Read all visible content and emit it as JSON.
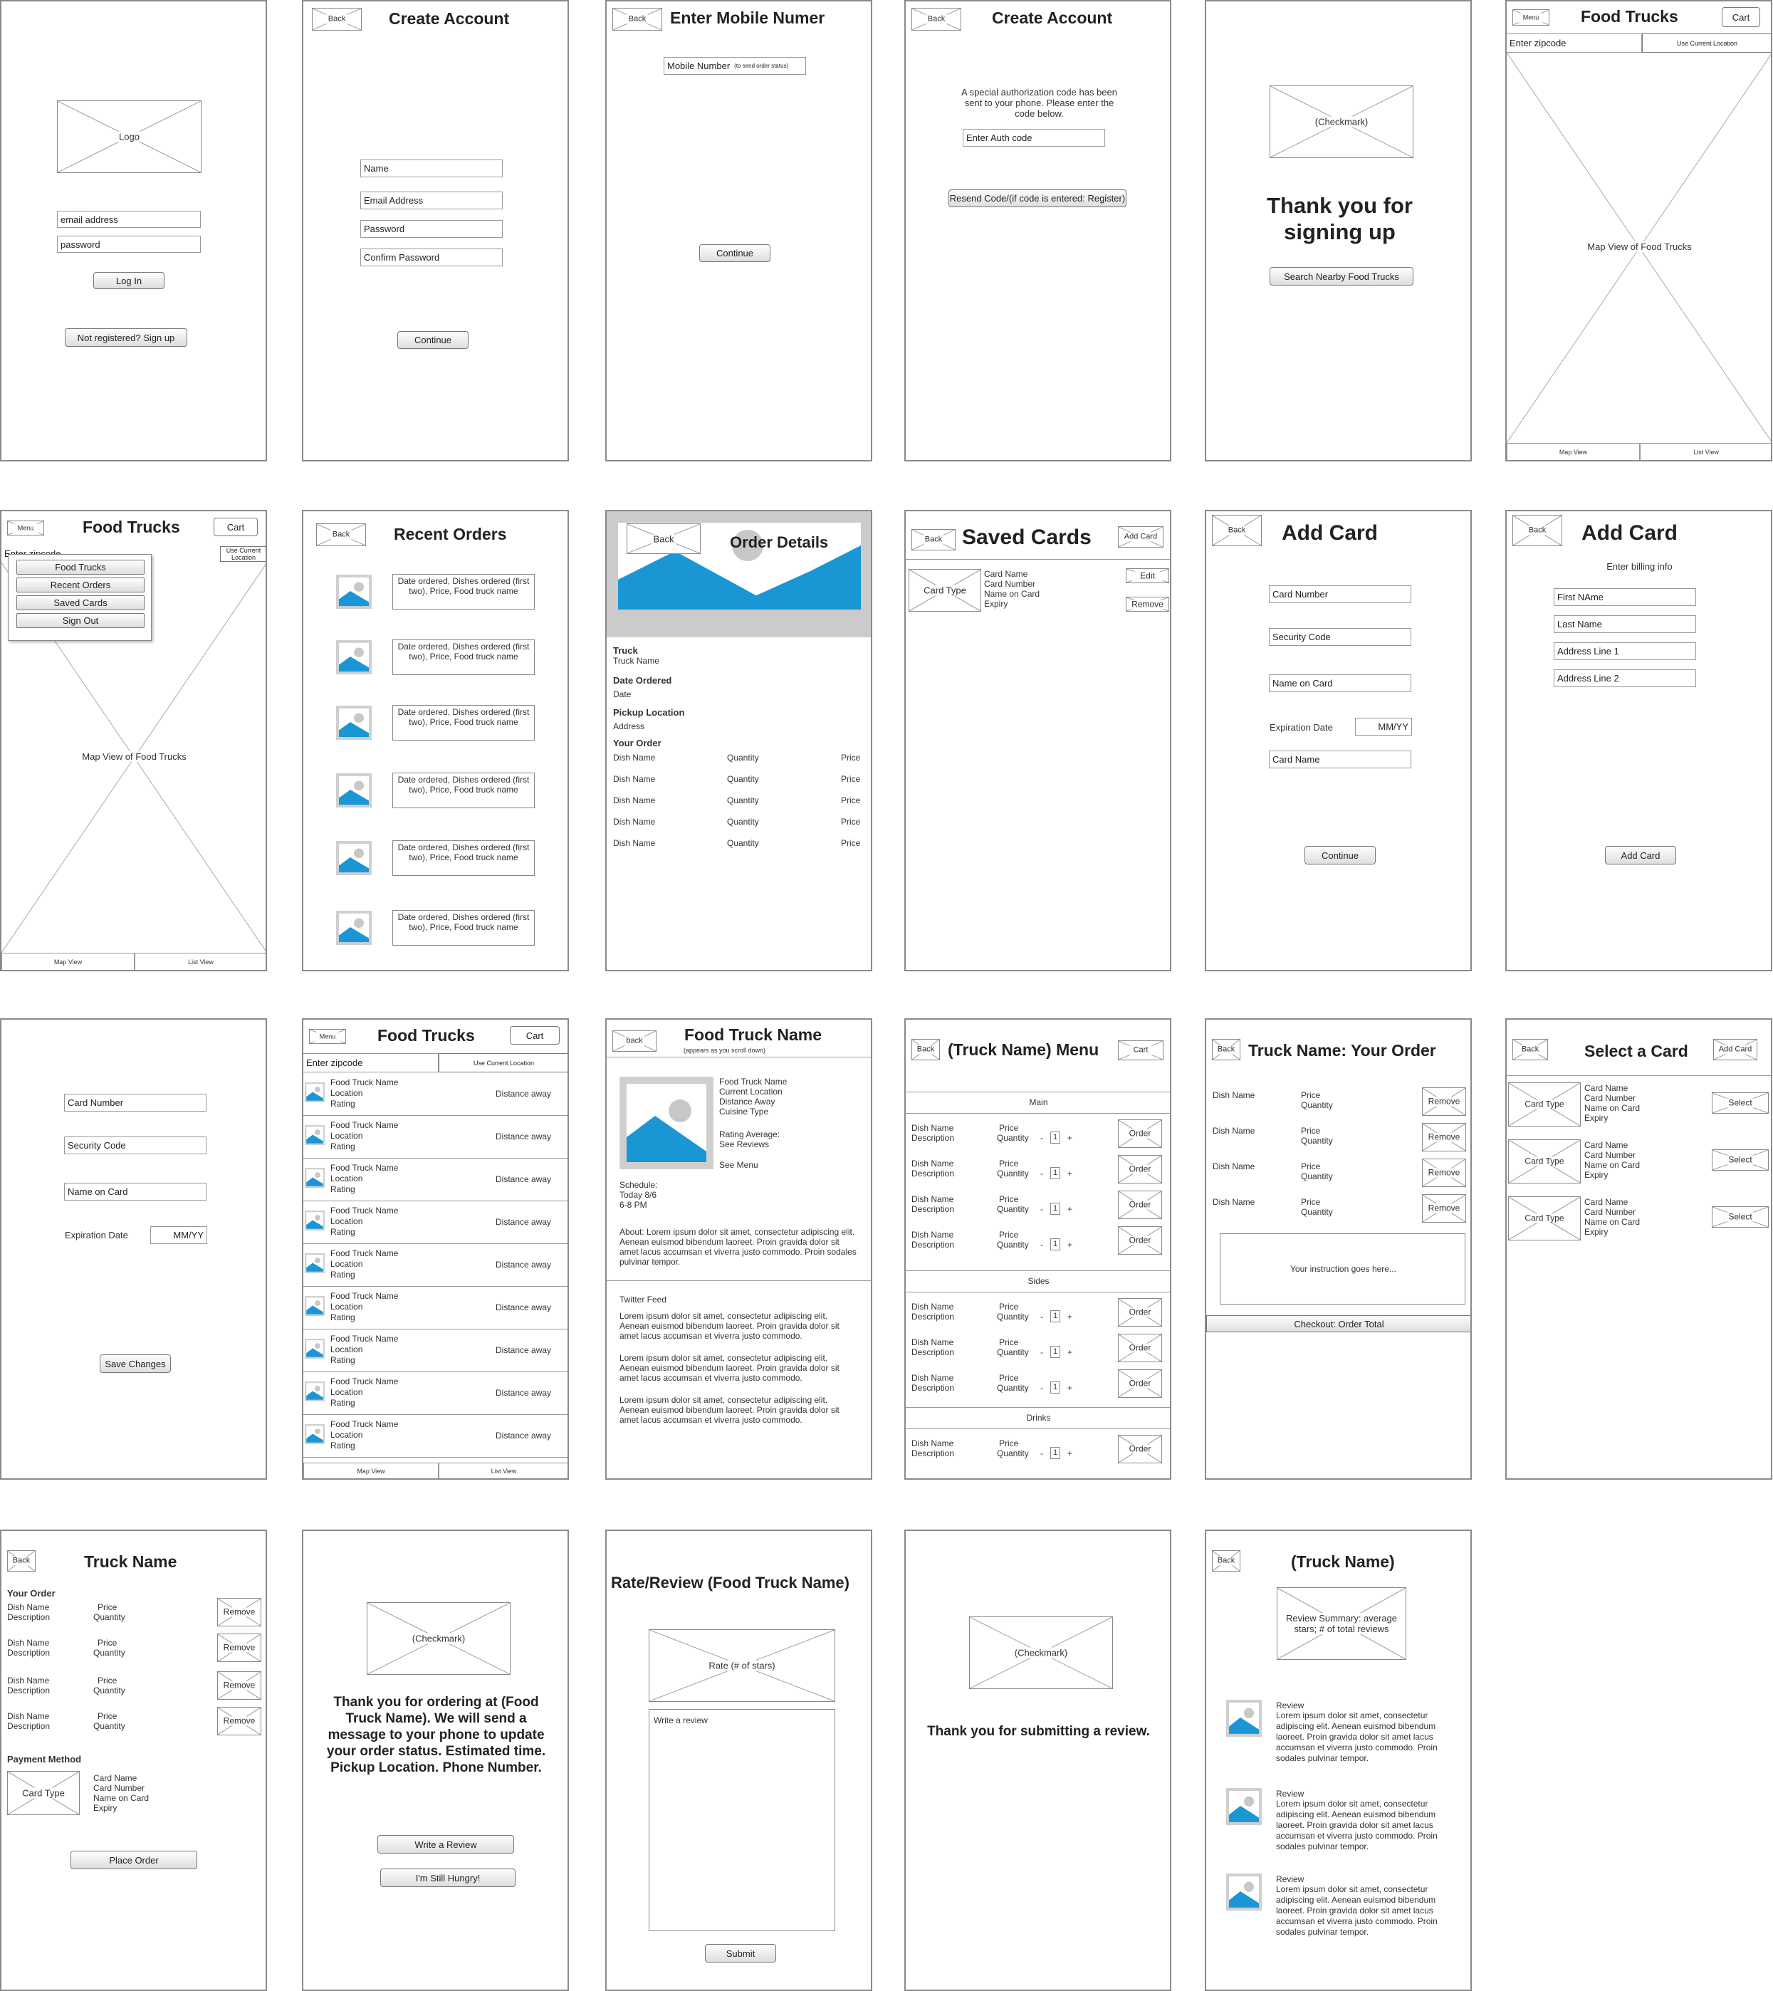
{
  "common": {
    "back": "Back",
    "back_lower": "back",
    "cart": "Cart",
    "menu": "Menu",
    "continue": "Continue",
    "map_view": "Map View",
    "list_view": "List View",
    "enter_zipcode": "Enter zipcode",
    "use_current_location": "Use Current Location",
    "checkmark": "(Checkmark)",
    "card_type": "Card Type",
    "card_name": "Card Name",
    "card_number": "Card Number",
    "name_on_card": "Name on Card",
    "expiry": "Expiry",
    "security_code": "Security Code",
    "expiration_date": "Expiration Date",
    "mmyy": "MM/YY",
    "dish_name": "Dish Name",
    "description": "Description",
    "price": "Price",
    "quantity": "Quantity",
    "remove": "Remove",
    "order": "Order",
    "select": "Select",
    "minus": "-",
    "plus": "+",
    "qty_value": "1",
    "add_card": "Add Card",
    "lorem": "Lorem ipsum dolor sit amet, consectetur adipiscing elit. Aenean euismod bibendum laoreet. Proin gravida dolor sit amet lacus accumsan et viverra justo commodo.",
    "lorem_sodales": "Lorem ipsum dolor sit amet, consectetur adipiscing elit. Aenean euismod bibendum laoreet. Proin gravida dolor sit amet lacus accumsan et viverra justo commodo. Proin sodales pulvinar tempor."
  },
  "login": {
    "logo": "Logo",
    "email": "email address",
    "password": "password",
    "login_button": "Log In",
    "signup_button": "Not registered? Sign up"
  },
  "create_account": {
    "title": "Create Account",
    "name": "Name",
    "email": "Email Address",
    "password": "Password",
    "confirm": "Confirm Password"
  },
  "mobile": {
    "title": "Enter Mobile Numer",
    "field": "Mobile Number",
    "hint": "(to send order status)"
  },
  "auth": {
    "title": "Create Account",
    "message": "A special authorization code has been sent to your phone. Please enter the code below.",
    "field": "Enter Auth code",
    "resend": "Resend Code/(if code is entered: Register)"
  },
  "thanks": {
    "title": "Thank you for signing up",
    "search_button": "Search Nearby Food Trucks"
  },
  "map": {
    "title": "Food Trucks",
    "map_label": "Map View of Food Trucks"
  },
  "menu_open": {
    "title": "Food Trucks",
    "zip_partial": "Enter zipcode",
    "items": [
      "Food Trucks",
      "Recent Orders",
      "Saved Cards",
      "Sign Out"
    ]
  },
  "recent": {
    "title": "Recent Orders",
    "item": "Date ordered, Dishes ordered (first two), Price, Food truck name"
  },
  "order_details": {
    "title": "Order Details",
    "truck_h": "Truck",
    "truck": "Truck Name",
    "date_h": "Date Ordered",
    "date": "Date",
    "pickup_h": "Pickup Location",
    "address": "Address",
    "your_order_h": "Your Order"
  },
  "saved_cards": {
    "title": "Saved Cards",
    "edit": "Edit"
  },
  "add_card": {
    "title": "Add Card"
  },
  "add_card2": {
    "title": "Add Card",
    "subtitle": "Enter billing info",
    "first": "First NAme",
    "last": "Last Name",
    "addr1": "Address Line 1",
    "addr2": "Address Line 2"
  },
  "edit_card": {
    "save": "Save Changes"
  },
  "list": {
    "title": "Food Trucks",
    "name": "Food Truck Name",
    "location": "Location",
    "rating": "Rating",
    "distance": "Distance away"
  },
  "truck_page": {
    "title": "Food Truck Name",
    "subtitle": "(appears as you scroll down)",
    "info": [
      "Food Truck Name",
      "Current Location",
      "Distance Away",
      "Cuisine Type"
    ],
    "rating_avg": "Rating Average:",
    "see_reviews": "See Reviews",
    "see_menu": "See Menu",
    "schedule": [
      "Schedule:",
      "Today 8/6",
      "6-8 PM"
    ],
    "about": "About: Lorem ipsum dolor sit amet, consectetur adipiscing elit. Aenean euismod bibendum laoreet. Proin gravida dolor sit amet lacus accumsan et viverra justo commodo. Proin sodales pulvinar tempor.",
    "twitter": "Twitter Feed"
  },
  "truck_menu": {
    "title": "(Truck Name) Menu",
    "main": "Main",
    "sides": "Sides",
    "drinks": "Drinks"
  },
  "your_order": {
    "title": "Truck Name: Your Order",
    "instructions": "Your instruction goes here...",
    "checkout": "Checkout: Order Total"
  },
  "select_card": {
    "title": "Select a Card"
  },
  "confirm_order": {
    "title": "Truck Name",
    "your_order": "Your Order",
    "payment": "Payment Method",
    "place": "Place Order"
  },
  "thanks_order": {
    "message": "Thank you for ordering at (Food Truck Name). We will send a message to your phone to update your order status. Estimated time. Pickup Location. Phone Number.",
    "review_btn": "Write a Review",
    "hungry_btn": "I'm Still Hungry!"
  },
  "rate": {
    "title": "Rate/Review (Food Truck Name)",
    "rate": "Rate (# of stars)",
    "write": "Write a review",
    "submit": "Submit"
  },
  "thanks_review": {
    "message": "Thank you for submitting a review."
  },
  "reviews": {
    "title": "(Truck Name)",
    "summary": "Review Summary: average stars; # of total reviews",
    "label": "Review"
  }
}
